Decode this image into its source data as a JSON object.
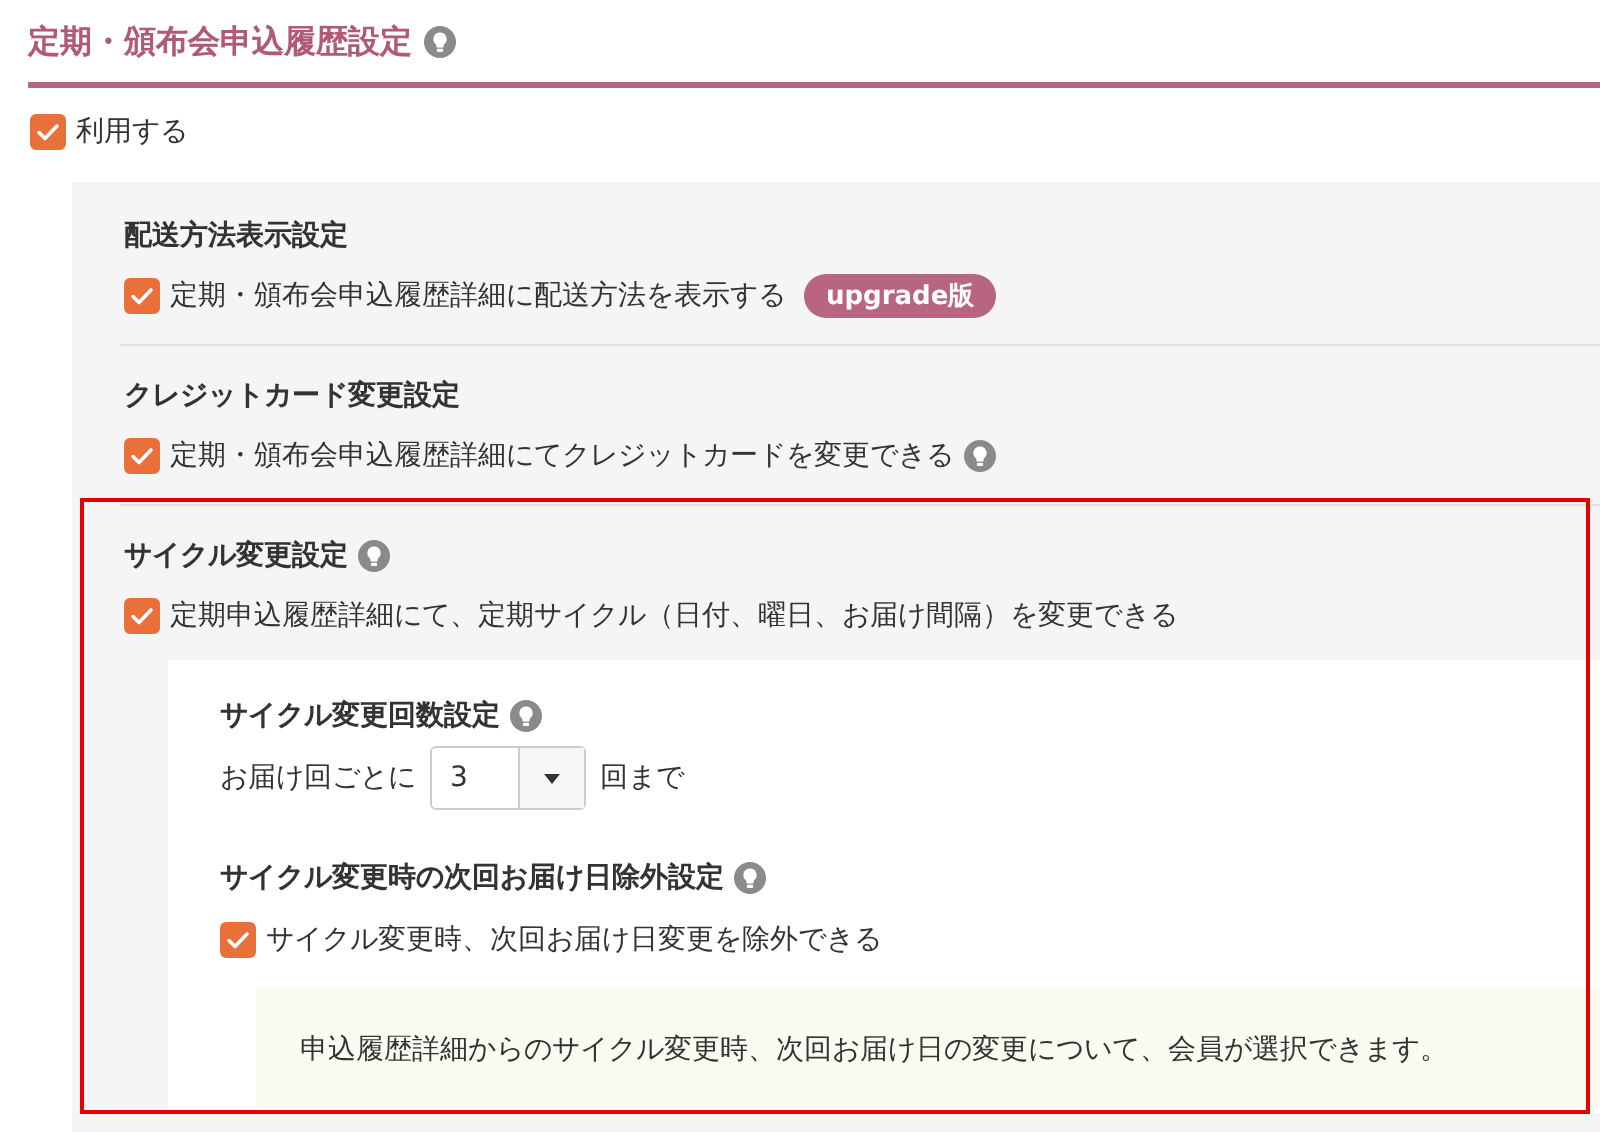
{
  "title": "定期・頒布会申込履歴設定",
  "title_tip": true,
  "use": {
    "label": "利用する",
    "checked": true
  },
  "sections": [
    {
      "heading": "配送方法表示設定",
      "tip": false,
      "highlighted": false,
      "option": {
        "label": "定期・頒布会申込履歴詳細に配送方法を表示する",
        "checked": true,
        "tip": false,
        "badge": "upgrade版"
      }
    },
    {
      "heading": "クレジットカード変更設定",
      "tip": false,
      "highlighted": false,
      "option": {
        "label": "定期・頒布会申込履歴詳細にてクレジットカードを変更できる",
        "checked": true,
        "tip": true
      }
    },
    {
      "heading": "サイクル変更設定",
      "tip": true,
      "highlighted": true,
      "option": {
        "label": "定期申込履歴詳細にて、定期サイクル（日付、曜日、お届け間隔）を変更できる",
        "checked": true,
        "tip": false
      },
      "subsections": [
        {
          "kind": "select",
          "heading": "サイクル変更回数設定",
          "tip": true,
          "prefix": "お届け回ごとに",
          "value": "3",
          "suffix": "回まで"
        },
        {
          "kind": "checkbox",
          "heading": "サイクル変更時の次回お届け日除外設定",
          "tip": true,
          "label": "サイクル変更時、次回お届け日変更を除外できる",
          "checked": true,
          "note": "申込履歴詳細からのサイクル変更時、次回お届け日の変更について、会員が選択できます。"
        }
      ]
    }
  ]
}
